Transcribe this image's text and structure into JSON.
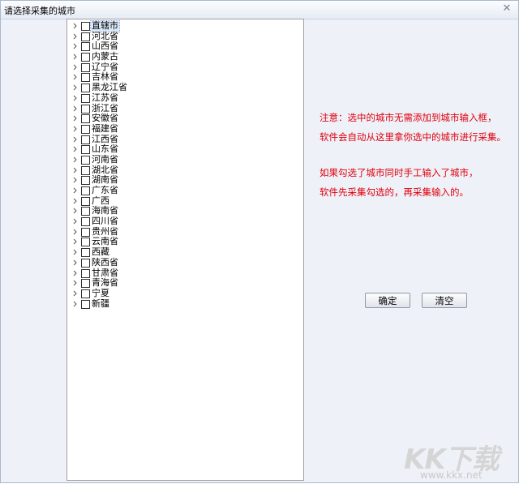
{
  "window": {
    "title": "请选择采集的城市",
    "close_glyph": "✕"
  },
  "tree": {
    "items": [
      {
        "label": "直辖市",
        "checked": false,
        "selected": true
      },
      {
        "label": "河北省",
        "checked": false
      },
      {
        "label": "山西省",
        "checked": false
      },
      {
        "label": "内蒙古",
        "checked": false
      },
      {
        "label": "辽宁省",
        "checked": false
      },
      {
        "label": "吉林省",
        "checked": false
      },
      {
        "label": "黑龙江省",
        "checked": false
      },
      {
        "label": "江苏省",
        "checked": false
      },
      {
        "label": "浙江省",
        "checked": false
      },
      {
        "label": "安徽省",
        "checked": false
      },
      {
        "label": "福建省",
        "checked": false
      },
      {
        "label": "江西省",
        "checked": false
      },
      {
        "label": "山东省",
        "checked": false
      },
      {
        "label": "河南省",
        "checked": false
      },
      {
        "label": "湖北省",
        "checked": false
      },
      {
        "label": "湖南省",
        "checked": false
      },
      {
        "label": "广东省",
        "checked": false
      },
      {
        "label": "广西",
        "checked": false
      },
      {
        "label": "海南省",
        "checked": false
      },
      {
        "label": "四川省",
        "checked": false
      },
      {
        "label": "贵州省",
        "checked": false
      },
      {
        "label": "云南省",
        "checked": false
      },
      {
        "label": "西藏",
        "checked": false
      },
      {
        "label": "陕西省",
        "checked": false
      },
      {
        "label": "甘肃省",
        "checked": false
      },
      {
        "label": "青海省",
        "checked": false
      },
      {
        "label": "宁夏",
        "checked": false
      },
      {
        "label": "新疆",
        "checked": false
      }
    ]
  },
  "notice": {
    "line1": "注意：选中的城市无需添加到城市输入框，",
    "line2": "软件会自动从这里拿你选中的城市进行采集。",
    "line3": "如果勾选了城市同时手工输入了城市，",
    "line4": "软件先采集勾选的，再采集输入的。",
    "color": "#e0000f"
  },
  "buttons": {
    "confirm_label": "确定",
    "clear_label": "清空"
  },
  "watermark": {
    "logo_text": "KK下载",
    "url": "www.kkx.net"
  }
}
